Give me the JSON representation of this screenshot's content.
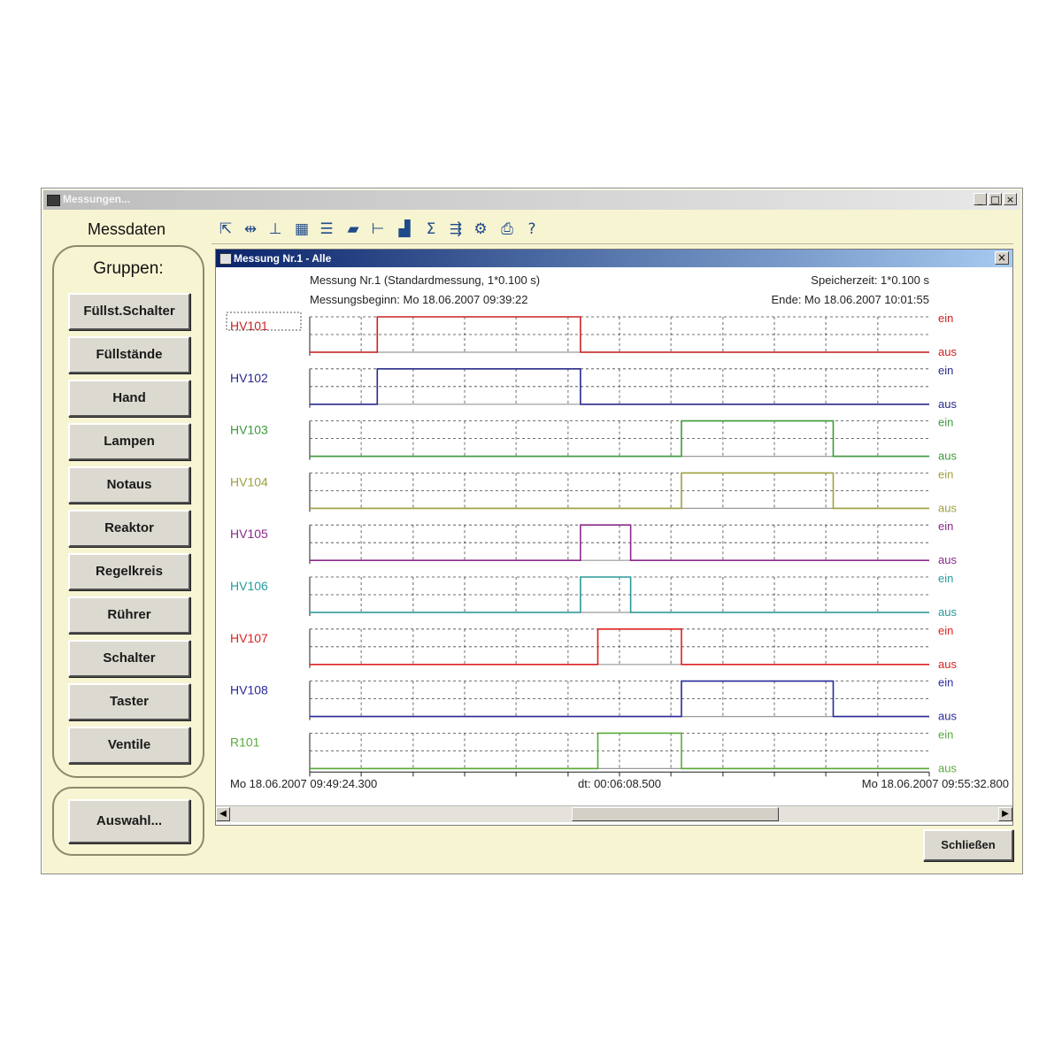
{
  "window": {
    "title": "Messungen..."
  },
  "left_panel": {
    "title": "Messdaten",
    "groups_title": "Gruppen:",
    "groups": [
      "Füllst.Schalter",
      "Füllstände",
      "Hand",
      "Lampen",
      "Notaus",
      "Reaktor",
      "Regelkreis",
      "Rührer",
      "Schalter",
      "Taster",
      "Ventile"
    ],
    "selection_button": "Auswahl..."
  },
  "toolbar": {
    "icons": [
      "zoom-all-icon",
      "zoom-time-icon",
      "zoom-y-icon",
      "grid-icon",
      "list-icon",
      "folder-icon",
      "axis-icon",
      "bar-chart-icon",
      "sum-icon",
      "export-icon",
      "settings-icon",
      "print-icon",
      "help-icon"
    ]
  },
  "child_window": {
    "title": "Messung Nr.1 - Alle"
  },
  "header": {
    "measurement": "Messung Nr.1 (Standardmessung, 1*0.100 s)",
    "storage_time": "Speicherzeit: 1*0.100 s",
    "start": "Messungsbeginn: Mo 18.06.2007 09:39:22",
    "end": "Ende: Mo 18.06.2007 10:01:55"
  },
  "footer": {
    "left_time": "Mo 18.06.2007 09:49:24.300",
    "dt": "dt: 00:06:08.500",
    "right_time": "Mo 18.06.2007 09:55:32.800"
  },
  "level_labels": {
    "on": "ein",
    "off": "aus"
  },
  "close_button": "Schließen",
  "chart_data": {
    "type": "line",
    "step": true,
    "x_unit": "fraction of visible window",
    "x_range": [
      0,
      1
    ],
    "series": [
      {
        "name": "HV101",
        "color": "#cc2222",
        "on_intervals": [
          [
            0.109,
            0.437
          ]
        ]
      },
      {
        "name": "HV102",
        "color": "#2a2a8c",
        "on_intervals": [
          [
            0.109,
            0.437
          ]
        ]
      },
      {
        "name": "HV103",
        "color": "#3c9a3c",
        "on_intervals": [
          [
            0.6,
            0.845
          ]
        ]
      },
      {
        "name": "HV104",
        "color": "#a0a040",
        "on_intervals": [
          [
            0.6,
            0.845
          ]
        ]
      },
      {
        "name": "HV105",
        "color": "#8a2a8a",
        "on_intervals": [
          [
            0.437,
            0.518
          ]
        ]
      },
      {
        "name": "HV106",
        "color": "#2a9a9a",
        "on_intervals": [
          [
            0.437,
            0.518
          ]
        ]
      },
      {
        "name": "HV107",
        "color": "#dd2222",
        "on_intervals": [
          [
            0.465,
            0.6
          ]
        ]
      },
      {
        "name": "HV108",
        "color": "#2a2a9a",
        "on_intervals": [
          [
            0.6,
            0.845
          ]
        ]
      },
      {
        "name": "R101",
        "color": "#5aaa3a",
        "on_intervals": [
          [
            0.465,
            0.6
          ]
        ]
      }
    ]
  }
}
